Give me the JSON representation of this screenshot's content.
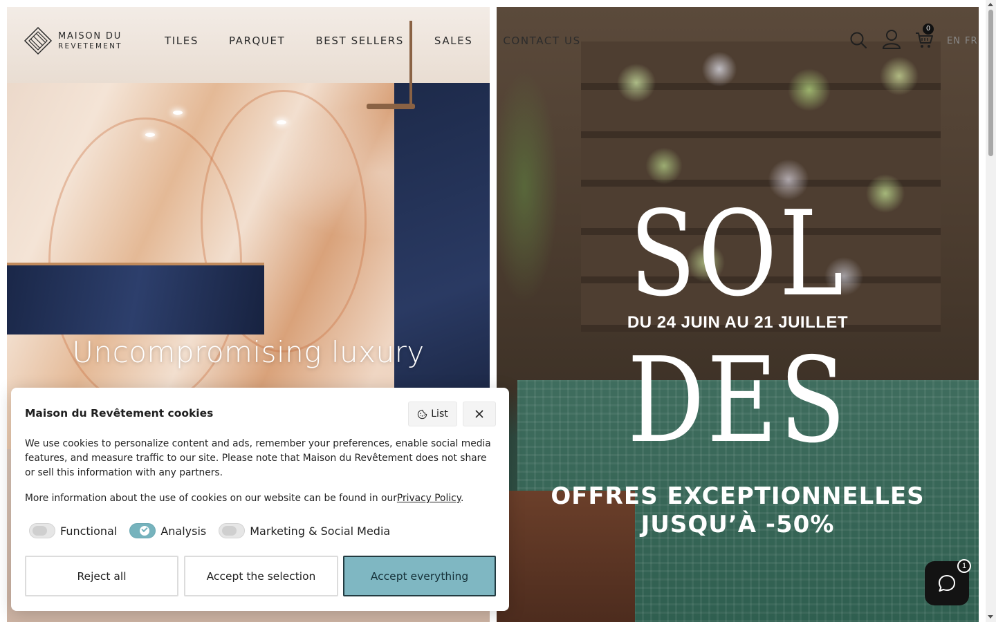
{
  "brand": {
    "line1": "MAISON DU",
    "line2": "REVETEMENT"
  },
  "nav": {
    "items": [
      {
        "label": "TILES"
      },
      {
        "label": "PARQUET"
      },
      {
        "label": "BEST SELLERS"
      },
      {
        "label": "SALES"
      },
      {
        "label": "CONTACT US"
      }
    ]
  },
  "header_tools": {
    "search_icon": "search-icon",
    "account_icon": "user-icon",
    "cart_icon": "cart-icon",
    "cart_count": "0",
    "languages": [
      "EN",
      "FR"
    ]
  },
  "hero_left": {
    "title": "Uncompromising luxury"
  },
  "hero_right": {
    "line1": "SOL",
    "dates": "DU 24 JUIN AU 21 JUILLET",
    "line2": "DES",
    "offer1": "OFFRES EXCEPTIONNELLES",
    "offer2": "JUSQU’À -50%"
  },
  "cookie": {
    "title": "Maison du Revêtement cookies",
    "list_label": "List",
    "text": "We use cookies to personalize content and ads, remember your preferences, enable social media features, and measure traffic to our site. Please note that Maison du Revêtement does not share or sell this information with any partners.",
    "more_text": "More information about the use of cookies on our website can be found in our",
    "policy_link": "Privacy Policy",
    "policy_suffix": ".",
    "toggles": [
      {
        "label": "Functional",
        "on": false
      },
      {
        "label": "Analysis",
        "on": true
      },
      {
        "label": "Marketing & Social Media",
        "on": false
      }
    ],
    "buttons": {
      "reject": "Reject all",
      "selection": "Accept the selection",
      "accept": "Accept everything"
    },
    "accent_color": "#7fb7c2"
  },
  "chat": {
    "icon": "chat-icon",
    "badge": "1"
  }
}
